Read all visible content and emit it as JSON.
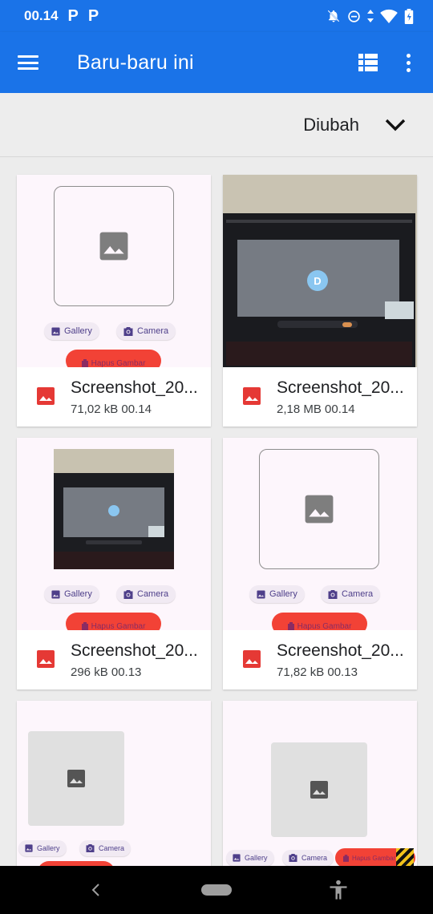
{
  "status_bar": {
    "time": "00.14",
    "notif_1": "P",
    "notif_2": "P"
  },
  "app_bar": {
    "title": "Baru-baru ini",
    "menu_icon": "hamburger-icon",
    "view_icon": "grid-view-icon",
    "more_icon": "more-vert-icon"
  },
  "sort": {
    "label": "Diubah"
  },
  "files": [
    {
      "name": "Screenshot_20...",
      "meta": "71,02 kB 00.14",
      "thumb": "app-placeholder"
    },
    {
      "name": "Screenshot_20...",
      "meta": "2,18 MB 00.14",
      "thumb": "laptop-photo"
    },
    {
      "name": "Screenshot_20...",
      "meta": "296 kB 00.13",
      "thumb": "app-photo"
    },
    {
      "name": "Screenshot_20...",
      "meta": "71,82 kB 00.13",
      "thumb": "app-placeholder"
    },
    {
      "name": "",
      "meta": "",
      "thumb": "app-gray"
    },
    {
      "name": "",
      "meta": "",
      "thumb": "app-gray"
    }
  ],
  "thumb_ui": {
    "gallery": "Gallery",
    "camera": "Camera",
    "delete": "Hapus Gambar",
    "avatar_letter": "D"
  },
  "colors": {
    "primary": "#1a73e8",
    "file_icon": "#e53935",
    "delete_button": "#f24236"
  }
}
